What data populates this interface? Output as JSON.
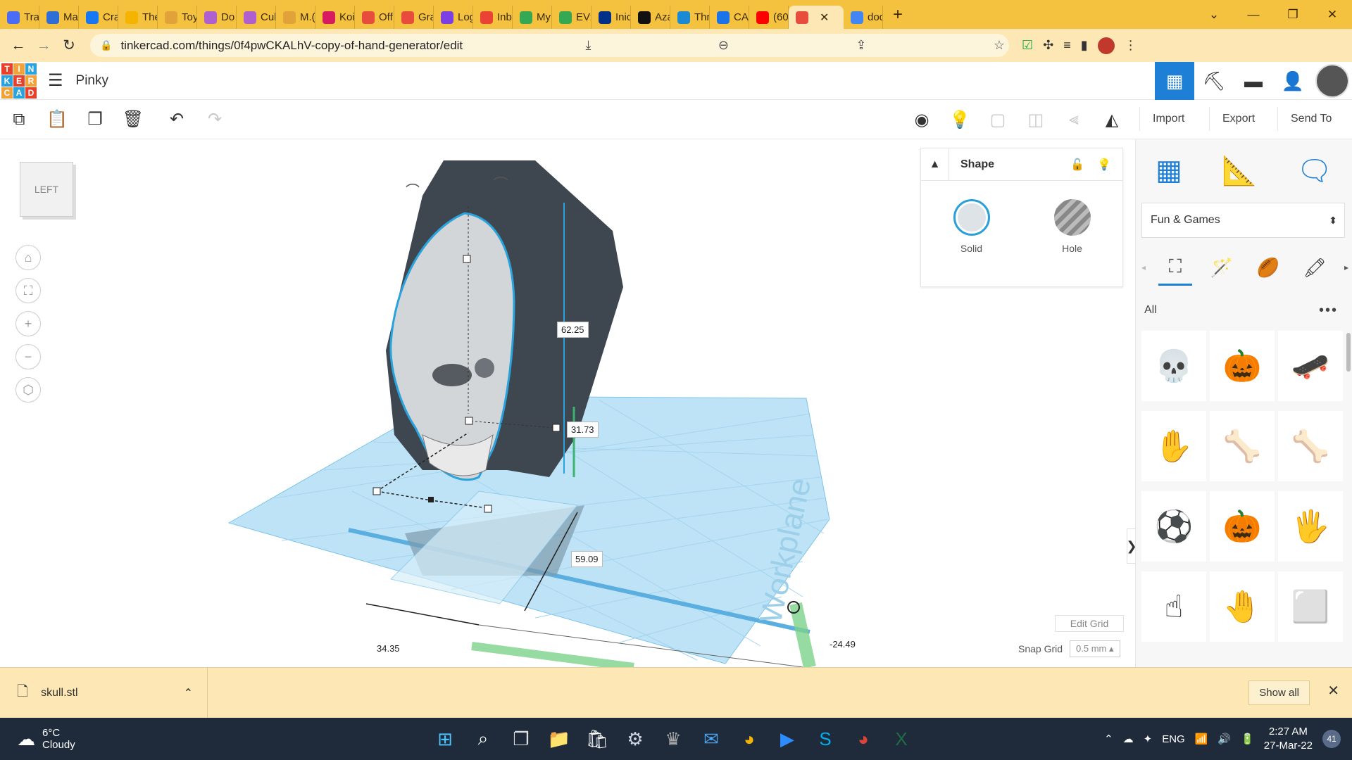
{
  "browser": {
    "tabs": [
      {
        "label": "Tra",
        "color": "#4a6cf7"
      },
      {
        "label": "Ma",
        "color": "#2d6fd6"
      },
      {
        "label": "Cra",
        "color": "#1877f2"
      },
      {
        "label": "The",
        "color": "#f4b400"
      },
      {
        "label": "Toy",
        "color": "#e2a23a"
      },
      {
        "label": "Do",
        "color": "#b05fd1"
      },
      {
        "label": "Cul",
        "color": "#b05fd1"
      },
      {
        "label": "M.(",
        "color": "#e2a23a"
      },
      {
        "label": "Koi",
        "color": "#d81b60"
      },
      {
        "label": "Off",
        "color": "#e74c3c"
      },
      {
        "label": "Gra",
        "color": "#e74c3c"
      },
      {
        "label": "Log",
        "color": "#7b3fe4"
      },
      {
        "label": "Inb",
        "color": "#ea4335"
      },
      {
        "label": "My",
        "color": "#34a853"
      },
      {
        "label": "EV:",
        "color": "#34a853"
      },
      {
        "label": "Inic",
        "color": "#003087"
      },
      {
        "label": "Aza",
        "color": "#111111"
      },
      {
        "label": "Thr",
        "color": "#1a8ad4"
      },
      {
        "label": "CAI",
        "color": "#1a73e8"
      },
      {
        "label": "(60",
        "color": "#ff0000"
      }
    ],
    "active_tab": {
      "label": "",
      "color": "#e74c3c"
    },
    "last_tab": {
      "label": "doc",
      "color": "#4285f4"
    },
    "url": "tinkercad.com/things/0f4pwCKALhV-copy-of-hand-generator/edit"
  },
  "app": {
    "logo_letters": [
      "T",
      "I",
      "N",
      "K",
      "E",
      "R",
      "C",
      "A",
      "D"
    ],
    "logo_colors": [
      "#e8412b",
      "#f2a23a",
      "#2aa3dc",
      "#2aa3dc",
      "#e8412b",
      "#f2a23a",
      "#f2a23a",
      "#2aa3dc",
      "#e8412b"
    ],
    "project_name": "Pinky"
  },
  "toolbar": {
    "import": "Import",
    "export": "Export",
    "send_to": "Send To"
  },
  "viewcube": {
    "label": "LEFT"
  },
  "shape_panel": {
    "title": "Shape",
    "solid": "Solid",
    "hole": "Hole"
  },
  "dimensions": {
    "height": "62.25",
    "depth": "31.73",
    "width": "59.09",
    "length": "34.35",
    "offset": "-24.49"
  },
  "grid_controls": {
    "edit_grid": "Edit Grid",
    "snap_grid_label": "Snap Grid",
    "snap_grid_value": "0.5 mm"
  },
  "workplane_label": "Workplane",
  "sidebar": {
    "category": "Fun & Games",
    "filter": "All",
    "items": [
      "skull",
      "pumpkin",
      "skateboard",
      "hand",
      "hand-bones",
      "finger-bone",
      "soccer-ball",
      "pumpkin-small",
      "skeleton-hand",
      "finger",
      "hand-skeleton",
      "cube"
    ]
  },
  "download": {
    "file": "skull.stl",
    "show_all": "Show all"
  },
  "taskbar": {
    "temp": "6°C",
    "condition": "Cloudy",
    "lang": "ENG",
    "time": "2:27 AM",
    "date": "27-Mar-22",
    "notifications": "41"
  }
}
